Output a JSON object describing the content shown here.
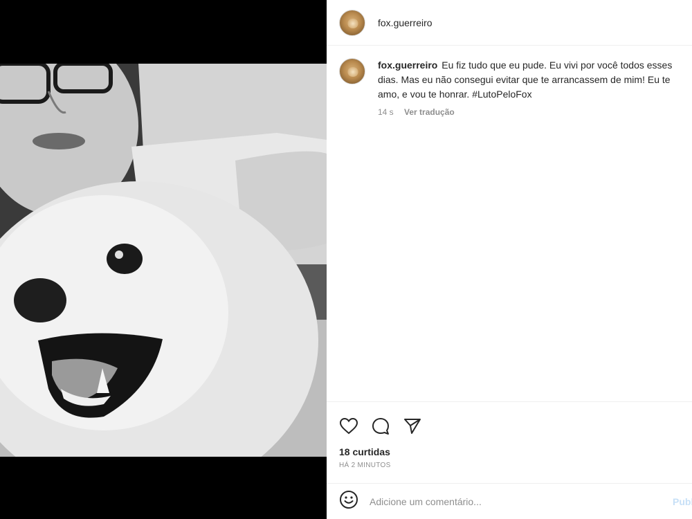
{
  "post": {
    "author": "fox.guerreiro",
    "caption": {
      "username": "fox.guerreiro",
      "text": "Eu fiz tudo que eu pude. Eu vivi por você todos esses dias. Mas eu não consegui evitar que te arrancassem de mim! Eu te amo, e vou te honrar. #LutoPeloFox",
      "age": "14 s",
      "translate_label": "Ver tradução"
    },
    "likes_label": "18 curtidas",
    "time_ago": "HÁ 2 MINUTOS"
  },
  "comment_box": {
    "placeholder": "Adicione um comentário...",
    "publish_label": "Publicar"
  },
  "icons": {
    "like": "heart-icon",
    "comment": "comment-icon",
    "share": "send-icon",
    "emoji": "emoji-icon"
  },
  "colors": {
    "text": "#262626",
    "secondary": "#8e8e8e",
    "divider": "#efefef",
    "publish_disabled": "#c7e0f7"
  }
}
